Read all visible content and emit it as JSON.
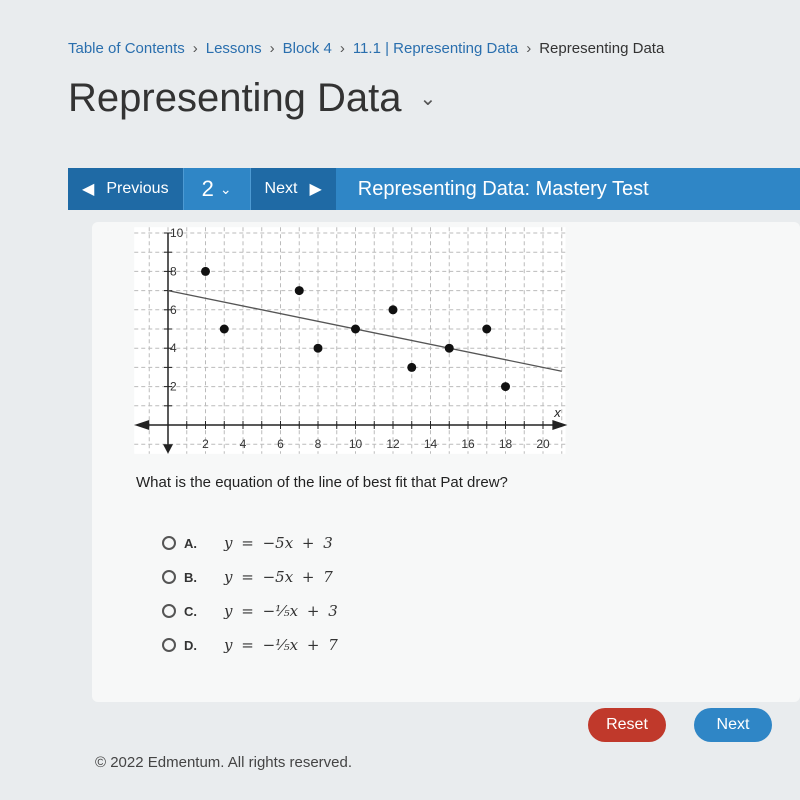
{
  "breadcrumb": [
    "Table of Contents",
    "Lessons",
    "Block 4",
    "11.1 | Representing Data",
    "Representing Data"
  ],
  "page_title": "Representing Data",
  "toolbar": {
    "previous_label": "Previous",
    "page_number": "2",
    "next_label": "Next",
    "test_title": "Representing Data: Mastery Test"
  },
  "question": "What is the equation of the line of best fit that Pat drew?",
  "options": [
    {
      "letter": "A.",
      "equation": "y = −5x + 3"
    },
    {
      "letter": "B.",
      "equation": "y = −5x + 7"
    },
    {
      "letter": "C.",
      "equation": "y = −⅕x + 3"
    },
    {
      "letter": "D.",
      "equation": "y = −⅕x + 7"
    }
  ],
  "buttons": {
    "reset": "Reset",
    "next": "Next"
  },
  "footer": "© 2022 Edmentum. All rights reserved.",
  "colors": {
    "toolbar": "#2f86c6",
    "toolbar_dark": "#1f6aa5",
    "reset": "#c0392b",
    "link": "#2a6fae"
  },
  "chart_data": {
    "type": "scatter",
    "xlabel": "x",
    "ylabel": "",
    "xlim": [
      -1,
      21
    ],
    "ylim": [
      -1,
      10
    ],
    "grid": true,
    "x_ticks": [
      2,
      4,
      6,
      8,
      10,
      12,
      14,
      16,
      18,
      20
    ],
    "y_ticks": [
      2,
      4,
      6,
      8,
      10
    ],
    "points": [
      [
        2,
        8
      ],
      [
        3,
        5
      ],
      [
        7,
        7
      ],
      [
        8,
        4
      ],
      [
        10,
        5
      ],
      [
        12,
        6
      ],
      [
        13,
        3
      ],
      [
        15,
        4
      ],
      [
        17,
        5
      ],
      [
        18,
        2
      ]
    ],
    "best_fit_line": {
      "slope": -0.2,
      "intercept": 7
    }
  }
}
